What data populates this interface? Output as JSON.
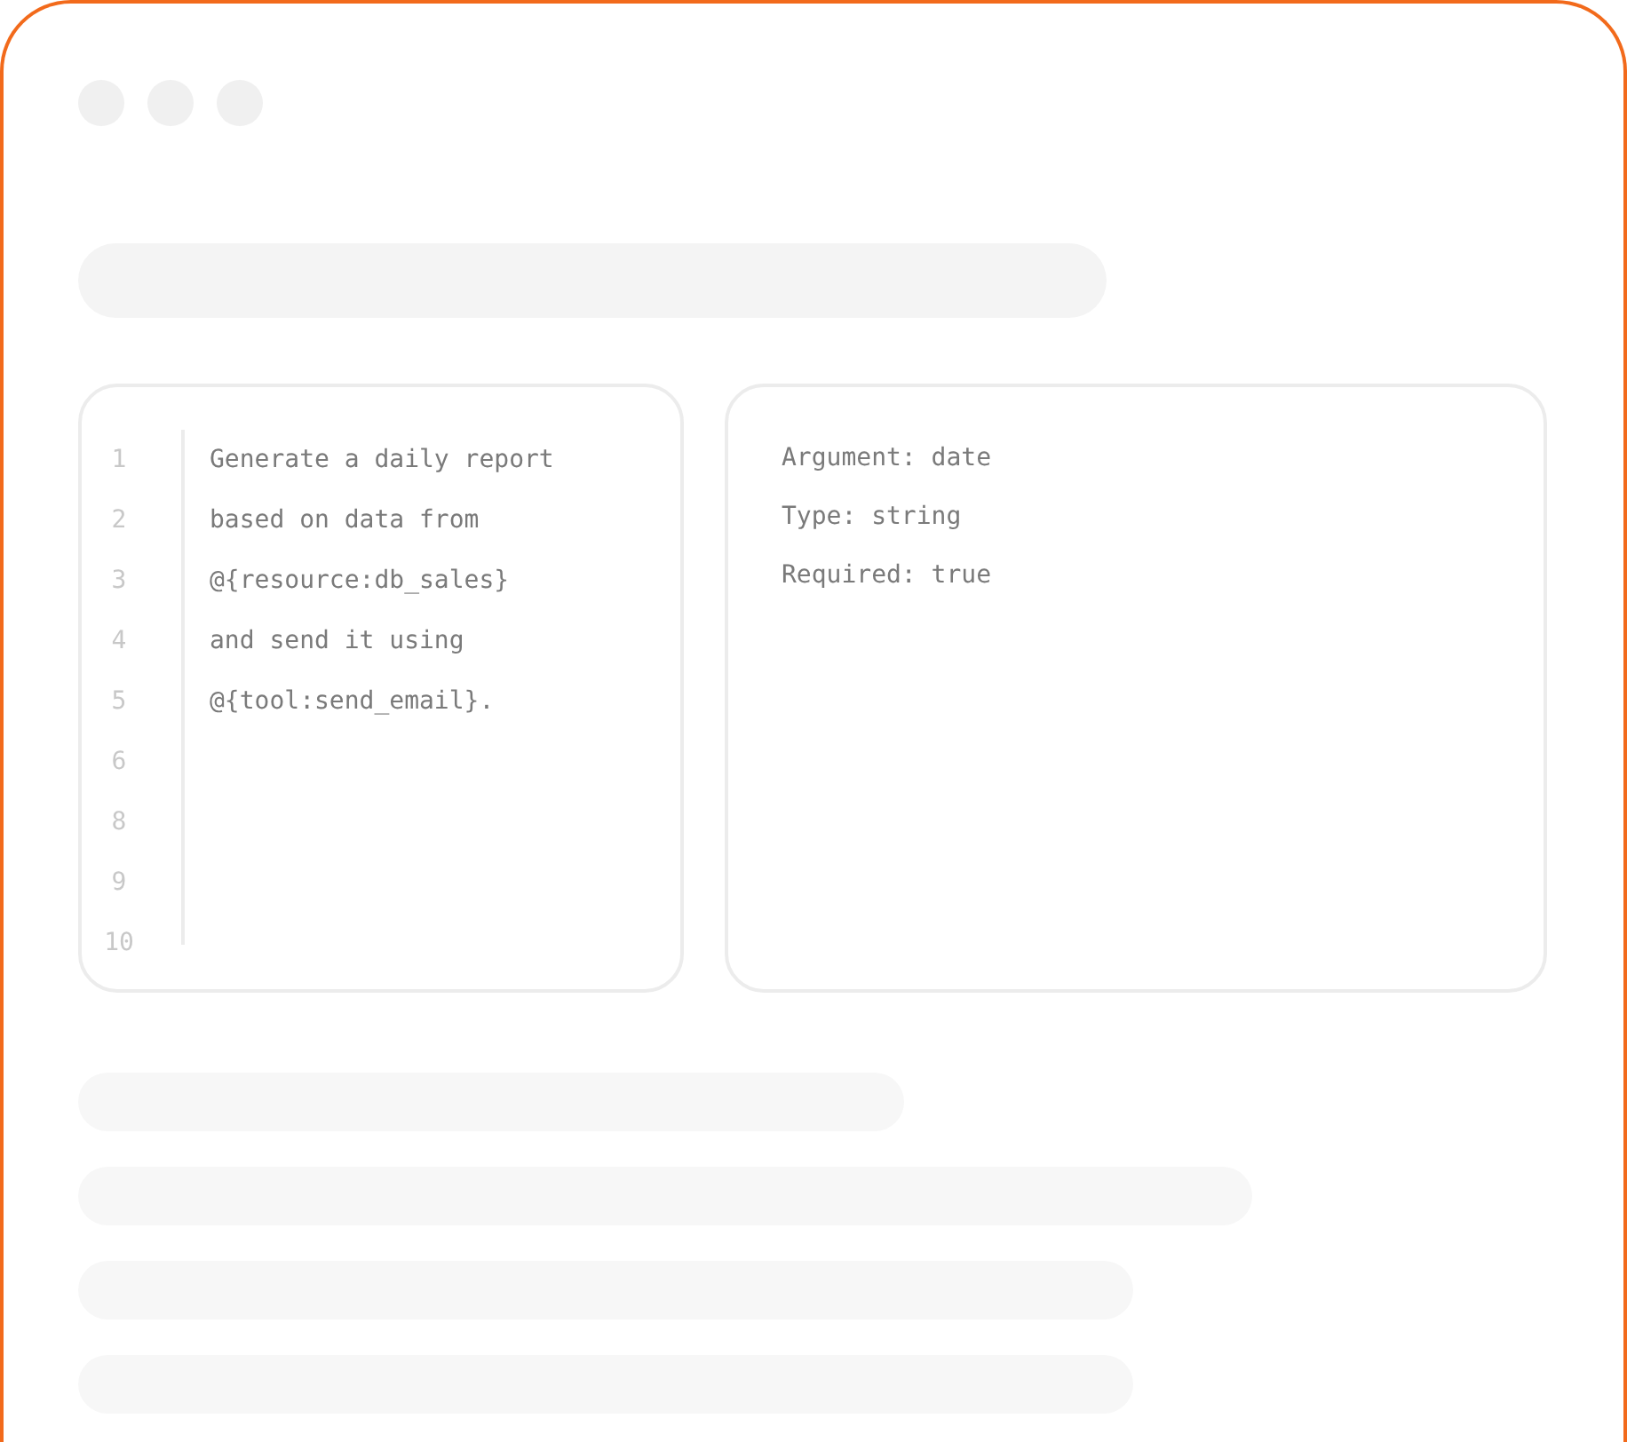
{
  "editor": {
    "lines": [
      {
        "number": "1",
        "text": "Generate a daily report"
      },
      {
        "number": "2",
        "text": "based on data from"
      },
      {
        "number": "3",
        "text": "@{resource:db_sales}"
      },
      {
        "number": "4",
        "text": "and send it using"
      },
      {
        "number": "5",
        "text": "@{tool:send_email}."
      },
      {
        "number": "6"
      },
      {
        "number": "8"
      },
      {
        "number": "9"
      },
      {
        "number": "10"
      }
    ]
  },
  "details": {
    "lines": [
      "Argument: date",
      "Type: string",
      "Required: true"
    ]
  }
}
